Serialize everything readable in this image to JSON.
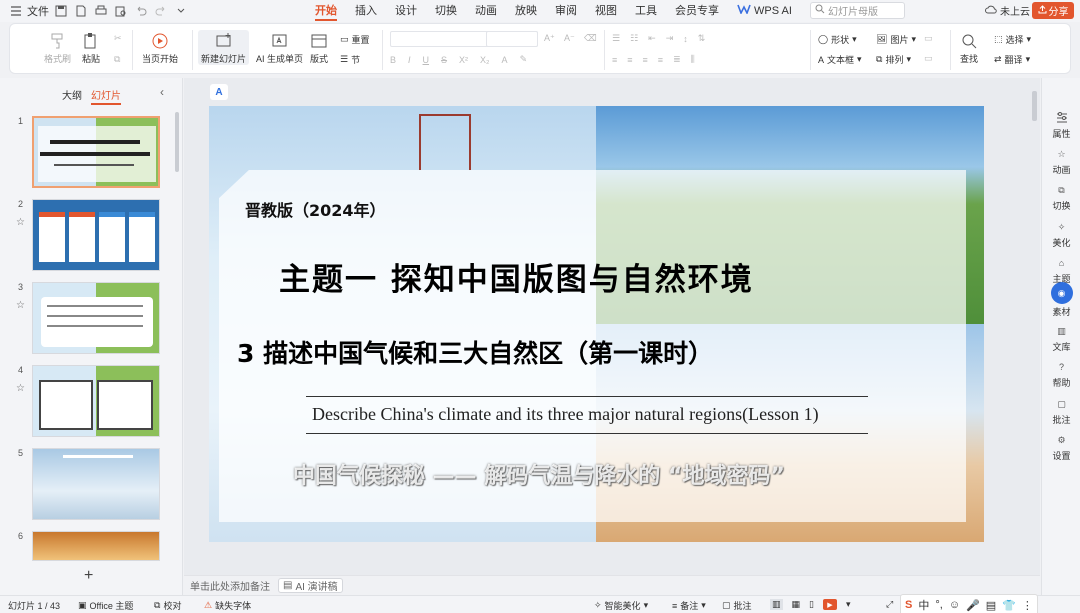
{
  "titlebar": {
    "file_label": "文件",
    "tabs": [
      "开始",
      "插入",
      "设计",
      "切换",
      "动画",
      "放映",
      "审阅",
      "视图",
      "工具",
      "会员专享",
      "WPS AI"
    ],
    "active_tab": "开始",
    "search_placeholder": "幻灯片母版",
    "cloud_label": "未上云",
    "share_label": "分享"
  },
  "ribbon": {
    "format_painter": "格式刷",
    "paste": "粘贴",
    "start_from_current": "当页开始",
    "new_slide": "新建幻灯片",
    "ai_slide": "AI 生成单页",
    "layout": "版式",
    "reset": "重置",
    "section": "节",
    "shape": "形状",
    "picture": "图片",
    "textbox": "文本框",
    "arrange": "排列",
    "find": "查找",
    "select": "选择",
    "translate": "翻译",
    "font_size_a_plus": "A⁺",
    "font_size_a_minus": "A⁻"
  },
  "left_panel": {
    "tab_outline": "大纲",
    "tab_slides": "幻灯片",
    "thumbnails": [
      {
        "num": "1"
      },
      {
        "num": "2"
      },
      {
        "num": "3"
      },
      {
        "num": "4"
      },
      {
        "num": "5"
      },
      {
        "num": "6"
      }
    ],
    "add_label": "+"
  },
  "slide": {
    "edition": "晋教版（2024年）",
    "title": "主题一  探知中国版图与自然环境",
    "subtitle": "3  描述中国气候和三大自然区（第一课时）",
    "english": "Describe China's climate and its three major natural regions(Lesson 1)",
    "tagline": "中国气候探秘 —— 解码气温与降水的 “地域密码”"
  },
  "notes": {
    "placeholder": "单击此处添加备注",
    "ai_lecture": "AI 演讲稿"
  },
  "right_sidebar": [
    "属性",
    "动画",
    "切换",
    "美化",
    "主题",
    "素材",
    "文库",
    "帮助",
    "批注",
    "设置"
  ],
  "status": {
    "slide_count": "幻灯片 1 / 43",
    "theme": "Office 主题",
    "proofread": "校对",
    "missing_font": "缺失字体",
    "smart_beautify": "智能美化",
    "notes": "备注",
    "comments": "批注"
  },
  "colors": {
    "accent": "#e2562e",
    "selected_sidebar": "#2f6fde"
  }
}
